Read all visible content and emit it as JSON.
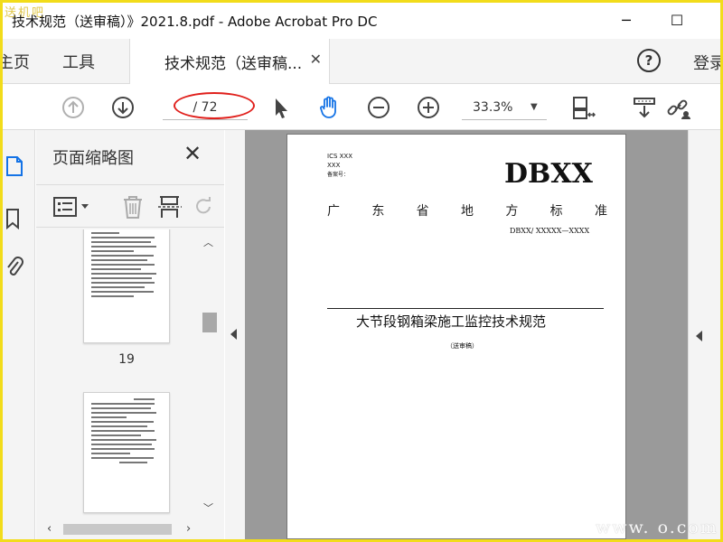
{
  "watermark_top": "送机吧",
  "titlebar": {
    "title": "技术规范（送审稿）》2021.8.pdf - Adobe Acrobat Pro DC",
    "minimize": "─",
    "maximize": "☐"
  },
  "tabs": {
    "home": "主页",
    "tools": "工具",
    "document": "技术规范（送审稿...",
    "close": "✕",
    "help": "?",
    "login": "登录"
  },
  "toolbar": {
    "page_current": "",
    "page_total": "/ 72",
    "zoom": "33.3%",
    "zoom_arrow": "▼",
    "icons": [
      "page-up-icon",
      "page-down-icon",
      "select-arrow-icon",
      "hand-tool-icon",
      "zoom-out-icon",
      "zoom-in-icon",
      "page-display-icon",
      "scroll-icon",
      "share-link-icon"
    ]
  },
  "thumbnail_pane": {
    "title": "页面缩略图",
    "close": "✕",
    "pages": [
      {
        "number": "19"
      },
      {
        "number": ""
      }
    ]
  },
  "document": {
    "ics": "ICS XXX",
    "xxx": "XXX",
    "record": "备案号：",
    "code": "DBXX",
    "province_chars": [
      "广",
      "东",
      "省",
      "地",
      "方",
      "标",
      "准"
    ],
    "number": "DBXX/ XXXXX—XXXX",
    "title": "大节段钢箱梁施工监控技术规范",
    "status": "（送审稿）"
  },
  "colors": {
    "accent_blue": "#1473e6",
    "annotation_red": "#e0201c",
    "frame_yellow": "#f2dc1a"
  },
  "watermark_bottom": "www.    o.com"
}
